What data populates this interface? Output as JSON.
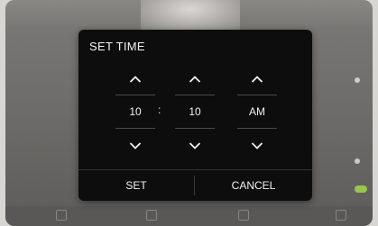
{
  "dialog": {
    "title": "SET TIME",
    "hour": "10",
    "separator": ":",
    "minute": "10",
    "period": "AM",
    "set_label": "SET",
    "cancel_label": "CANCEL",
    "icons": {
      "up": "chevron-up-icon",
      "down": "chevron-down-icon"
    }
  },
  "colors": {
    "dialog_bg": "#0d0d0d",
    "toggle_on": "#9bd14a"
  }
}
